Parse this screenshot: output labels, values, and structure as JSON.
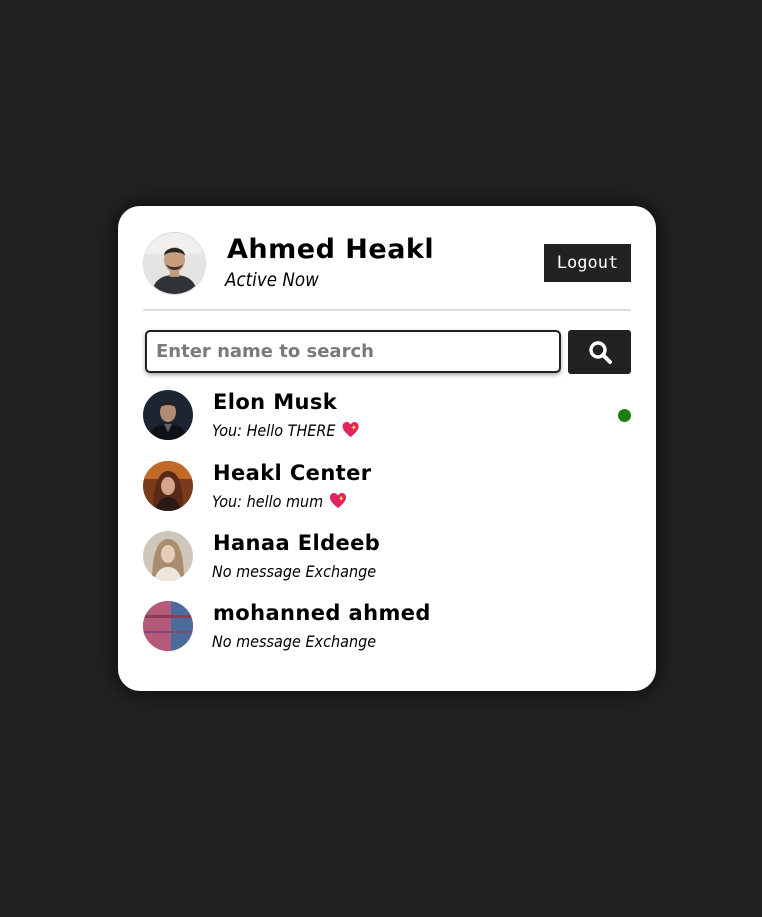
{
  "colors": {
    "page_background": "#222222",
    "card_background": "#ffffff",
    "button_background": "#222222",
    "online_dot": "#1a7f0f"
  },
  "header": {
    "name": "Ahmed Heakl",
    "status": "Active Now",
    "logout_label": "Logout",
    "avatar_icon": "user-photo-avatar"
  },
  "search": {
    "placeholder": "Enter name to search",
    "value": "",
    "button_icon": "search-icon"
  },
  "users": [
    {
      "name": "Elon Musk",
      "message": "You: Hello THERE",
      "emoji": "sparkling-heart",
      "online": true
    },
    {
      "name": "Heakl Center",
      "message": "You: hello mum",
      "emoji": "sparkling-heart",
      "online": false
    },
    {
      "name": "Hanaa Eldeeb",
      "message": "No message Exchange",
      "emoji": "",
      "online": false
    },
    {
      "name": "mohanned ahmed",
      "message": "No message Exchange",
      "emoji": "",
      "online": false
    }
  ]
}
